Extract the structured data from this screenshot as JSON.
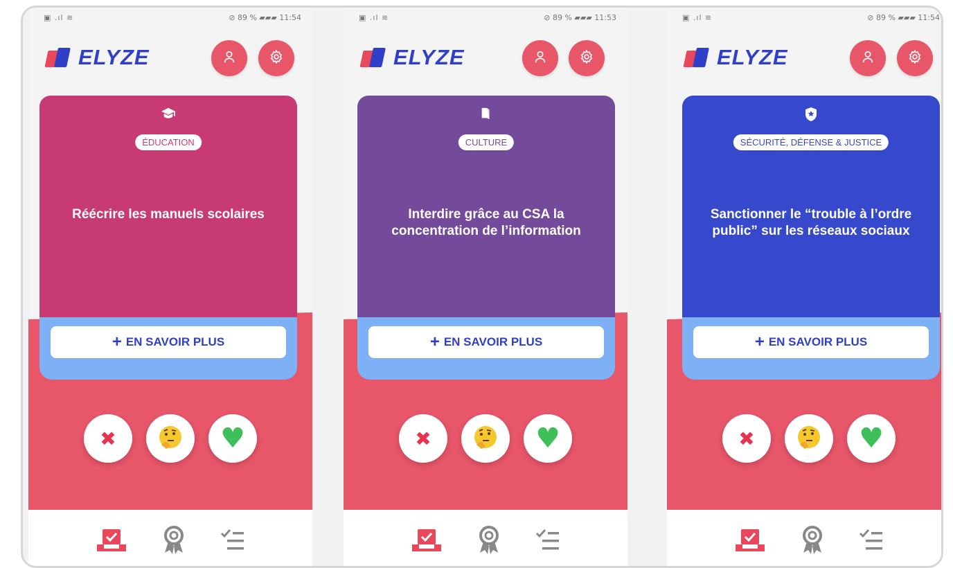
{
  "app": {
    "name": "ELYZE",
    "colors": {
      "brand_blue": "#2f3fc8",
      "brand_red": "#e8566a",
      "card_bottom_blue": "#7db0f4"
    }
  },
  "screens": [
    {
      "status": {
        "left": "▣ .ıl ≋",
        "right": "⊘ 89 % ▰▰▰ 11:54"
      },
      "card": {
        "color": "#c83b72",
        "icon": "graduation-cap-icon",
        "category": "ÉDUCATION",
        "proposal": "Réécrire les manuels scolaires",
        "more_label": "EN SAVOIR PLUS"
      }
    },
    {
      "status": {
        "left": "▣ .ıl ≋",
        "right": "⊘ 89 % ▰▰▰ 11:53"
      },
      "card": {
        "color": "#744b9b",
        "icon": "book-icon",
        "category": "CULTURE",
        "proposal": "Interdire grâce au CSA la concentration de l’information",
        "more_label": "EN SAVOIR PLUS"
      }
    },
    {
      "status": {
        "left": "▣ .ıl ≋",
        "right": "⊘ 89 % ▰▰▰ 11:54"
      },
      "card": {
        "color": "#3648cc",
        "icon": "police-badge-icon",
        "category": "SÉCURITÉ, DÉFENSE & JUSTICE",
        "proposal": "Sanctionner le “trouble à l’ordre public” sur les réseaux sociaux",
        "more_label": "EN SAVOIR PLUS"
      }
    }
  ],
  "votes": {
    "disagree_icon": "cross-icon",
    "unsure_icon": "thinking-face-icon",
    "agree_icon": "heart-icon",
    "disagree_glyph": "✖",
    "unsure_glyph": "🤔",
    "agree_glyph": "♥"
  },
  "tabs": [
    "vote-tab",
    "badges-tab",
    "results-tab"
  ]
}
